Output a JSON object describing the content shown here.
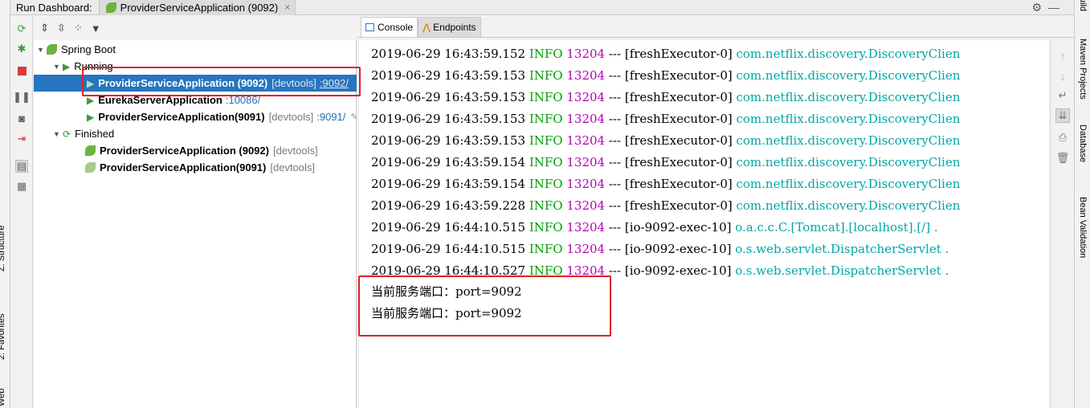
{
  "topbar": {
    "label": "Run Dashboard:",
    "tab_title": "ProviderServiceApplication (9092)",
    "tab_close": "×",
    "gear": "⚙",
    "minimize": "—"
  },
  "left_stripe": {
    "structure": "Z: Structure",
    "favorites": "2: Favorites",
    "web": "Web"
  },
  "right_stripe": {
    "ant": "Ant Build",
    "maven": "Maven Projects",
    "database": "Database",
    "bean": "Bean Validation"
  },
  "tree": {
    "root_label": "Spring Boot",
    "running_label": "Running",
    "finished_label": "Finished",
    "running": [
      {
        "name": "ProviderServiceApplication (9092)",
        "tag": "[devtools]",
        "port": ":9092/"
      },
      {
        "name": "EurekaServerApplication",
        "tag": "",
        "port": ":10086/"
      },
      {
        "name": "ProviderServiceApplication(9091)",
        "tag": "[devtools]",
        "port": ":9091/"
      }
    ],
    "finished": [
      {
        "name": "ProviderServiceApplication (9092)",
        "tag": "[devtools]"
      },
      {
        "name": "ProviderServiceApplication(9091)",
        "tag": "[devtools]"
      }
    ]
  },
  "console_tabs": {
    "console": "Console",
    "endpoints": "Endpoints"
  },
  "console": {
    "log_lines": [
      {
        "ts": "2019-06-29 16:43:59.152",
        "level": "INFO",
        "pid": "13204",
        "sep": "---",
        "thread": "[freshExecutor-0]",
        "logger": "com.netflix.discovery.DiscoveryClien"
      },
      {
        "ts": "2019-06-29 16:43:59.153",
        "level": "INFO",
        "pid": "13204",
        "sep": "---",
        "thread": "[freshExecutor-0]",
        "logger": "com.netflix.discovery.DiscoveryClien"
      },
      {
        "ts": "2019-06-29 16:43:59.153",
        "level": "INFO",
        "pid": "13204",
        "sep": "---",
        "thread": "[freshExecutor-0]",
        "logger": "com.netflix.discovery.DiscoveryClien"
      },
      {
        "ts": "2019-06-29 16:43:59.153",
        "level": "INFO",
        "pid": "13204",
        "sep": "---",
        "thread": "[freshExecutor-0]",
        "logger": "com.netflix.discovery.DiscoveryClien"
      },
      {
        "ts": "2019-06-29 16:43:59.153",
        "level": "INFO",
        "pid": "13204",
        "sep": "---",
        "thread": "[freshExecutor-0]",
        "logger": "com.netflix.discovery.DiscoveryClien"
      },
      {
        "ts": "2019-06-29 16:43:59.154",
        "level": "INFO",
        "pid": "13204",
        "sep": "---",
        "thread": "[freshExecutor-0]",
        "logger": "com.netflix.discovery.DiscoveryClien"
      },
      {
        "ts": "2019-06-29 16:43:59.154",
        "level": "INFO",
        "pid": "13204",
        "sep": "---",
        "thread": "[freshExecutor-0]",
        "logger": "com.netflix.discovery.DiscoveryClien"
      },
      {
        "ts": "2019-06-29 16:43:59.228",
        "level": "INFO",
        "pid": "13204",
        "sep": "---",
        "thread": "[freshExecutor-0]",
        "logger": "com.netflix.discovery.DiscoveryClien"
      },
      {
        "ts": "2019-06-29 16:44:10.515",
        "level": "INFO",
        "pid": "13204",
        "sep": "---",
        "thread": "[io-9092-exec-10]",
        "logger": "o.a.c.c.C.[Tomcat].[localhost].[/] ."
      },
      {
        "ts": "2019-06-29 16:44:10.515",
        "level": "INFO",
        "pid": "13204",
        "sep": "---",
        "thread": "[io-9092-exec-10]",
        "logger": "o.s.web.servlet.DispatcherServlet  ."
      },
      {
        "ts": "2019-06-29 16:44:10.527",
        "level": "INFO",
        "pid": "13204",
        "sep": "---",
        "thread": "[io-9092-exec-10]",
        "logger": "o.s.web.servlet.DispatcherServlet  ."
      }
    ],
    "output": [
      "当前服务端口：port=9092",
      "当前服务端口：port=9092"
    ]
  },
  "colors": {
    "selection": "#2675bf",
    "info": "#00a000",
    "pid": "#b400b4",
    "logger": "#00a6a6",
    "highlight_box": "#e0202a"
  }
}
